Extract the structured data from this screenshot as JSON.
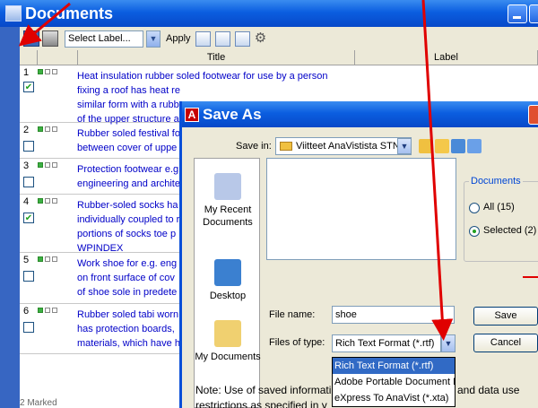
{
  "documents_window": {
    "title": "Documents",
    "toolbar": {
      "select_label": "Select Label...",
      "apply": "Apply"
    },
    "columns": [
      "Title",
      "Label"
    ],
    "rows": [
      {
        "num": "1",
        "checked": true,
        "text": "Heat insulation rubber soled footwear for use by a person\nfixing a roof has heat re\nsimilar form with a rubb\nof the upper structure a"
      },
      {
        "num": "2",
        "checked": false,
        "text": "Rubber soled festival fo\nbetween cover of uppe"
      },
      {
        "num": "3",
        "checked": false,
        "text": "Protection footwear e.g\nengineering and archite"
      },
      {
        "num": "4",
        "checked": true,
        "text": "Rubber-soled socks ha\nindividually coupled to r\nportions of socks toe p\nWPINDEX"
      },
      {
        "num": "5",
        "checked": false,
        "text": "Work shoe for e.g. eng\non front surface of cov\nof shoe sole in predete"
      },
      {
        "num": "6",
        "checked": false,
        "text": "Rubber soled tabi worn\nhas protection boards,\nmaterials, which have h"
      }
    ],
    "status": "2 Marked"
  },
  "save_as_dialog": {
    "title": "Save As",
    "save_in_label": "Save in:",
    "save_in_value": "Viitteet AnaVistista STN...",
    "places": [
      "My Recent Documents",
      "Desktop",
      "My Documents"
    ],
    "documents_group": {
      "legend": "Documents",
      "options": [
        {
          "label": "All (15)",
          "selected": false
        },
        {
          "label": "Selected (2)",
          "selected": true
        }
      ]
    },
    "file_name_label": "File name:",
    "file_name_value": "shoe",
    "files_of_type_label": "Files of type:",
    "files_of_type_value": "Rich Text Format (*.rtf)",
    "file_type_options": [
      "Rich Text Format (*.rtf)",
      "Adobe Portable Document Fo",
      "eXpress To AnaVist (*.xta)"
    ],
    "save_button": "Save",
    "cancel_button": "Cancel",
    "note": "Note: Use of saved informati",
    "note_tail": "and data use",
    "note_line2": "restrictions as specified in y"
  },
  "colors": {
    "titlebar": "#0b5ee0",
    "link_text": "#0000c8",
    "annotation_arrow": "#e00000",
    "selection": "#316ac5"
  }
}
